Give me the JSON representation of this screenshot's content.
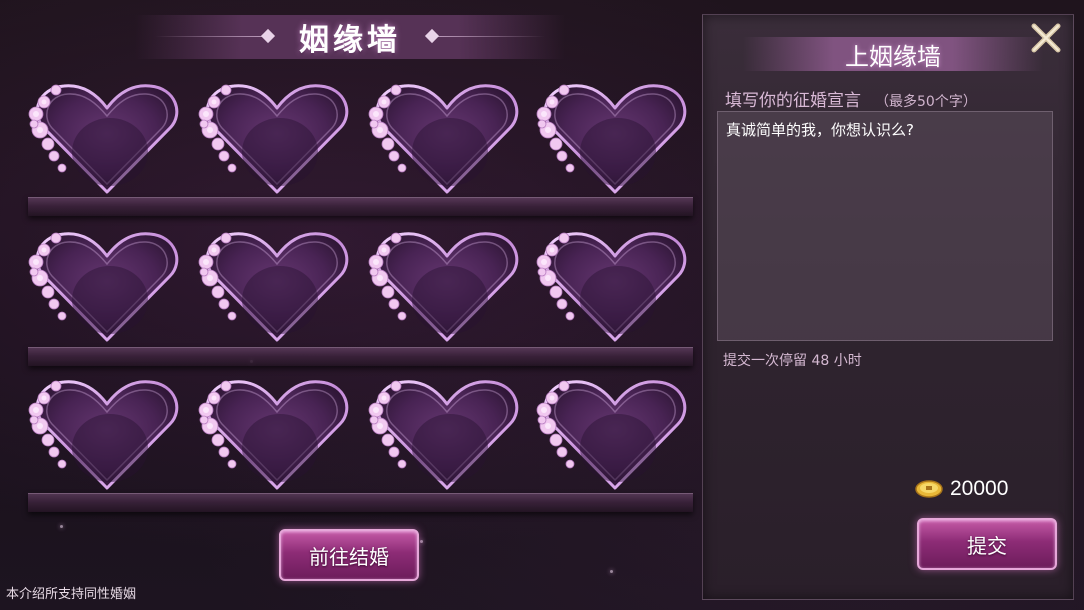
{
  "wall": {
    "title": "姻缘墙",
    "slots": [
      {
        "id": 1
      },
      {
        "id": 2
      },
      {
        "id": 3
      },
      {
        "id": 4
      },
      {
        "id": 5
      },
      {
        "id": 6
      },
      {
        "id": 7
      },
      {
        "id": 8
      },
      {
        "id": 9
      },
      {
        "id": 10
      },
      {
        "id": 11
      },
      {
        "id": 12
      }
    ],
    "go_marry_label": "前往结婚",
    "note": "本介绍所支持同性婚姻"
  },
  "panel": {
    "title": "上姻缘墙",
    "input_label": "填写你的征婚宣言",
    "input_hint": "（最多50个字）",
    "declaration_text": "真诚简单的我，你想认识么?",
    "stay_text": "提交一次停留 48 小时",
    "cost": "20000",
    "cost_icon": "gold-coin-icon",
    "submit_label": "提交",
    "close_icon": "close-x-icon"
  },
  "colors": {
    "accent_pink": "#c55aa7",
    "heart_glow": "#d9a6e6"
  }
}
